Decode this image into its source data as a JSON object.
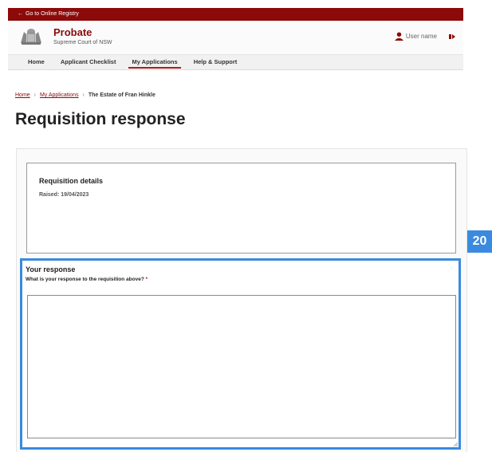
{
  "topbar": {
    "back_label": "Go to Online Registry"
  },
  "brand": {
    "title": "Probate",
    "subtitle": "Supreme Court of NSW"
  },
  "user": {
    "name": "User name"
  },
  "nav": {
    "items": [
      {
        "label": "Home"
      },
      {
        "label": "Applicant Checklist"
      },
      {
        "label": "My Applications",
        "active": true
      },
      {
        "label": "Help & Support"
      }
    ]
  },
  "breadcrumb": {
    "home": "Home",
    "applications": "My Applications",
    "current": "The Estate of Fran Hinkle"
  },
  "page": {
    "title": "Requisition response"
  },
  "details": {
    "title": "Requisition details",
    "raised": "Raised: 19/04/2023"
  },
  "badge": {
    "label": "20"
  },
  "response": {
    "title": "Your response",
    "question": "What is your response to the requisition above?",
    "required_mark": "*",
    "value": ""
  },
  "colors": {
    "brand": "#8c0a0a",
    "accent": "#3a8be0",
    "nav_active": "#b01c1c"
  }
}
